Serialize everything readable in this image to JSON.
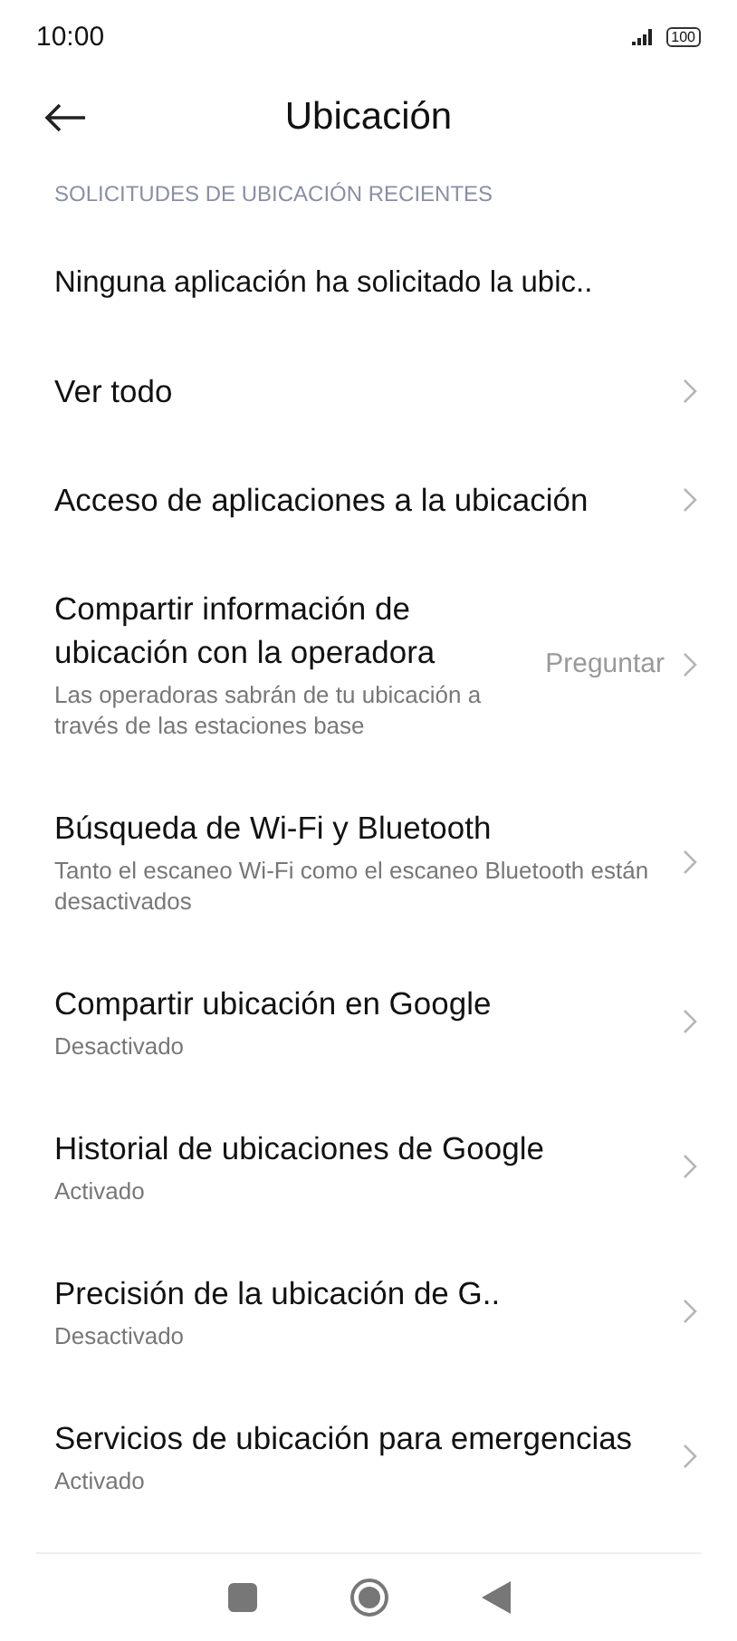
{
  "status_bar": {
    "time": "10:00",
    "battery": "100"
  },
  "header": {
    "title": "Ubicación"
  },
  "section": {
    "label": "SOLICITUDES DE UBICACIÓN RECIENTES"
  },
  "items": [
    {
      "title": "Ninguna aplicación ha solicitado la ubic..",
      "chevron": false
    },
    {
      "title": "Ver todo",
      "chevron": true
    },
    {
      "title": "Acceso de aplicaciones a la ubicación",
      "chevron": true
    },
    {
      "title": "Compartir información de ubicación con la operadora",
      "subtitle": "Las operadoras sabrán de tu ubicación a través de las estaciones base",
      "value": "Preguntar",
      "chevron": true
    },
    {
      "title": "Búsqueda de Wi-Fi y Bluetooth",
      "subtitle": "Tanto el escaneo Wi-Fi como el escaneo Bluetooth están desactivados",
      "chevron": true
    },
    {
      "title": "Compartir ubicación en Google",
      "subtitle": "Desactivado",
      "chevron": true
    },
    {
      "title": "Historial de ubicaciones de Google",
      "subtitle": "Activado",
      "chevron": true
    },
    {
      "title": "Precisión de la ubicación de G..",
      "subtitle": "Desactivado",
      "chevron": true
    },
    {
      "title": "Servicios de ubicación para emergencias",
      "subtitle": "Activado",
      "chevron": true
    }
  ]
}
